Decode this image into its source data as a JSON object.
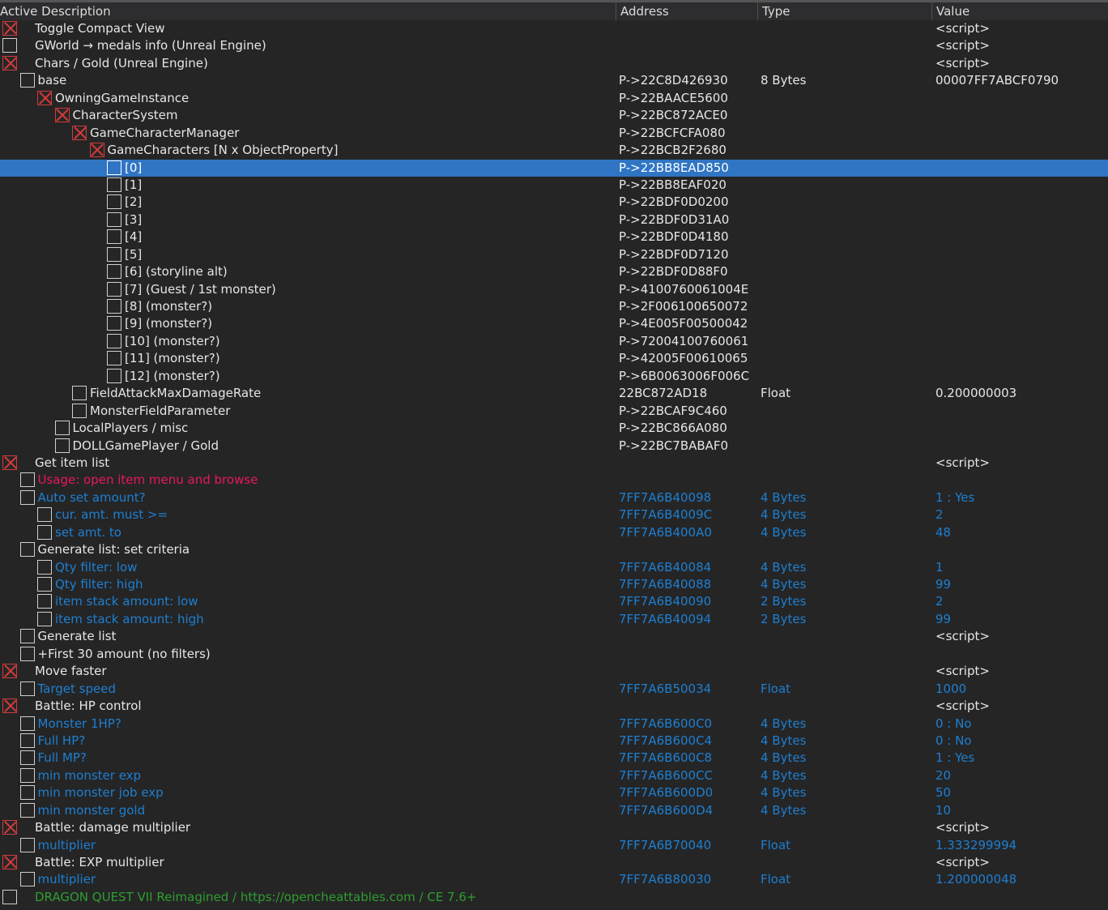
{
  "header": {
    "col_active_desc": "Active Description",
    "col_address": "Address",
    "col_type": "Type",
    "col_value": "Value"
  },
  "colors": {
    "selection": "#2f75c4",
    "blue_entry": "#1e7fd0",
    "usage": "#e8175d",
    "footer": "#2e9e2e",
    "checked_x": "#d23a3a"
  },
  "rows": [
    {
      "d": "Toggle Compact View",
      "a": "",
      "t": "",
      "v": "<script>",
      "lvl": 0,
      "chk": true,
      "c": ""
    },
    {
      "d": "GWorld → medals info  (Unreal Engine)",
      "a": "",
      "t": "",
      "v": "<script>",
      "lvl": 0,
      "chk": false,
      "c": ""
    },
    {
      "d": "Chars / Gold (Unreal Engine)",
      "a": "",
      "t": "",
      "v": "<script>",
      "lvl": 0,
      "chk": true,
      "c": ""
    },
    {
      "d": "base",
      "a": "P->22C8D426930",
      "t": "8 Bytes",
      "v": "00007FF7ABCF0790",
      "lvl": 1,
      "chk": false,
      "c": ""
    },
    {
      "d": "OwningGameInstance",
      "a": "P->22BAACE5600",
      "t": "",
      "v": "",
      "lvl": 2,
      "chk": true,
      "c": ""
    },
    {
      "d": "CharacterSystem",
      "a": "P->22BC872ACE0",
      "t": "",
      "v": "",
      "lvl": 3,
      "chk": true,
      "c": ""
    },
    {
      "d": "GameCharacterManager",
      "a": "P->22BCFCFA080",
      "t": "",
      "v": "",
      "lvl": 4,
      "chk": true,
      "c": ""
    },
    {
      "d": "GameCharacters [N x ObjectProperty]",
      "a": "P->22BCB2F2680",
      "t": "",
      "v": "",
      "lvl": 5,
      "chk": true,
      "c": ""
    },
    {
      "d": "[0]",
      "a": "P->22BB8EAD850",
      "t": "",
      "v": "",
      "lvl": 6,
      "chk": false,
      "c": "",
      "sel": true
    },
    {
      "d": "[1]",
      "a": "P->22BB8EAF020",
      "t": "",
      "v": "",
      "lvl": 6,
      "chk": false,
      "c": ""
    },
    {
      "d": "[2]",
      "a": "P->22BDF0D0200",
      "t": "",
      "v": "",
      "lvl": 6,
      "chk": false,
      "c": ""
    },
    {
      "d": "[3]",
      "a": "P->22BDF0D31A0",
      "t": "",
      "v": "",
      "lvl": 6,
      "chk": false,
      "c": ""
    },
    {
      "d": "[4]",
      "a": "P->22BDF0D4180",
      "t": "",
      "v": "",
      "lvl": 6,
      "chk": false,
      "c": ""
    },
    {
      "d": "[5]",
      "a": "P->22BDF0D7120",
      "t": "",
      "v": "",
      "lvl": 6,
      "chk": false,
      "c": ""
    },
    {
      "d": "[6] (storyline alt)",
      "a": "P->22BDF0D88F0",
      "t": "",
      "v": "",
      "lvl": 6,
      "chk": false,
      "c": ""
    },
    {
      "d": "[7] (Guest / 1st monster)",
      "a": "P->4100760061004E",
      "t": "",
      "v": "",
      "lvl": 6,
      "chk": false,
      "c": ""
    },
    {
      "d": "[8] (monster?)",
      "a": "P->2F006100650072",
      "t": "",
      "v": "",
      "lvl": 6,
      "chk": false,
      "c": ""
    },
    {
      "d": "[9] (monster?)",
      "a": "P->4E005F00500042",
      "t": "",
      "v": "",
      "lvl": 6,
      "chk": false,
      "c": ""
    },
    {
      "d": "[10] (monster?)",
      "a": "P->72004100760061",
      "t": "",
      "v": "",
      "lvl": 6,
      "chk": false,
      "c": ""
    },
    {
      "d": "[11] (monster?)",
      "a": "P->42005F00610065",
      "t": "",
      "v": "",
      "lvl": 6,
      "chk": false,
      "c": ""
    },
    {
      "d": "[12] (monster?)",
      "a": "P->6B0063006F006C",
      "t": "",
      "v": "",
      "lvl": 6,
      "chk": false,
      "c": ""
    },
    {
      "d": "FieldAttackMaxDamageRate",
      "a": "22BC872AD18",
      "t": "Float",
      "v": "0.200000003",
      "lvl": 4,
      "chk": false,
      "c": ""
    },
    {
      "d": "MonsterFieldParameter",
      "a": "P->22BCAF9C460",
      "t": "",
      "v": "",
      "lvl": 4,
      "chk": false,
      "c": ""
    },
    {
      "d": "LocalPlayers / misc",
      "a": "P->22BC866A080",
      "t": "",
      "v": "",
      "lvl": 3,
      "chk": false,
      "c": ""
    },
    {
      "d": "DOLLGamePlayer / Gold",
      "a": "P->22BC7BABAF0",
      "t": "",
      "v": "",
      "lvl": 3,
      "chk": false,
      "c": ""
    },
    {
      "d": "Get item list",
      "a": "",
      "t": "",
      "v": "<script>",
      "lvl": 0,
      "chk": true,
      "c": ""
    },
    {
      "d": "Usage: open item menu and browse",
      "a": "",
      "t": "",
      "v": "",
      "lvl": 1,
      "chk": false,
      "c": "pink"
    },
    {
      "d": "Auto set amount?",
      "a": "7FF7A6B40098",
      "t": "4 Bytes",
      "v": "1 : Yes",
      "lvl": 1,
      "chk": false,
      "c": "blue"
    },
    {
      "d": "cur. amt. must >=",
      "a": "7FF7A6B4009C",
      "t": "4 Bytes",
      "v": "2",
      "lvl": 2,
      "chk": false,
      "c": "blue"
    },
    {
      "d": "set amt. to",
      "a": "7FF7A6B400A0",
      "t": "4 Bytes",
      "v": "48",
      "lvl": 2,
      "chk": false,
      "c": "blue"
    },
    {
      "d": "Generate list: set criteria",
      "a": "",
      "t": "",
      "v": "",
      "lvl": 1,
      "chk": false,
      "c": ""
    },
    {
      "d": "Qty filter: low",
      "a": "7FF7A6B40084",
      "t": "4 Bytes",
      "v": "1",
      "lvl": 2,
      "chk": false,
      "c": "blue"
    },
    {
      "d": "Qty filter: high",
      "a": "7FF7A6B40088",
      "t": "4 Bytes",
      "v": "99",
      "lvl": 2,
      "chk": false,
      "c": "blue"
    },
    {
      "d": "item stack amount: low",
      "a": "7FF7A6B40090",
      "t": "2 Bytes",
      "v": "2",
      "lvl": 2,
      "chk": false,
      "c": "blue"
    },
    {
      "d": "item stack amount: high",
      "a": "7FF7A6B40094",
      "t": "2 Bytes",
      "v": "99",
      "lvl": 2,
      "chk": false,
      "c": "blue"
    },
    {
      "d": "Generate list",
      "a": "",
      "t": "",
      "v": "<script>",
      "lvl": 1,
      "chk": false,
      "c": ""
    },
    {
      "d": "+First 30 amount (no filters)",
      "a": "",
      "t": "",
      "v": "",
      "lvl": 1,
      "chk": false,
      "c": ""
    },
    {
      "d": "Move faster",
      "a": "",
      "t": "",
      "v": "<script>",
      "lvl": 0,
      "chk": true,
      "c": ""
    },
    {
      "d": "Target speed",
      "a": "7FF7A6B50034",
      "t": "Float",
      "v": "1000",
      "lvl": 1,
      "chk": false,
      "c": "blue"
    },
    {
      "d": "Battle: HP control",
      "a": "",
      "t": "",
      "v": "<script>",
      "lvl": 0,
      "chk": true,
      "c": ""
    },
    {
      "d": "Monster 1HP?",
      "a": "7FF7A6B600C0",
      "t": "4 Bytes",
      "v": "0 : No",
      "lvl": 1,
      "chk": false,
      "c": "blue"
    },
    {
      "d": "Full HP?",
      "a": "7FF7A6B600C4",
      "t": "4 Bytes",
      "v": "0 : No",
      "lvl": 1,
      "chk": false,
      "c": "blue"
    },
    {
      "d": "Full MP?",
      "a": "7FF7A6B600C8",
      "t": "4 Bytes",
      "v": "1 : Yes",
      "lvl": 1,
      "chk": false,
      "c": "blue"
    },
    {
      "d": "min monster exp",
      "a": "7FF7A6B600CC",
      "t": "4 Bytes",
      "v": "20",
      "lvl": 1,
      "chk": false,
      "c": "blue"
    },
    {
      "d": "min monster job exp",
      "a": "7FF7A6B600D0",
      "t": "4 Bytes",
      "v": "50",
      "lvl": 1,
      "chk": false,
      "c": "blue"
    },
    {
      "d": "min monster gold",
      "a": "7FF7A6B600D4",
      "t": "4 Bytes",
      "v": "10",
      "lvl": 1,
      "chk": false,
      "c": "blue"
    },
    {
      "d": "Battle: damage multiplier",
      "a": "",
      "t": "",
      "v": "<script>",
      "lvl": 0,
      "chk": true,
      "c": ""
    },
    {
      "d": "multiplier",
      "a": "7FF7A6B70040",
      "t": "Float",
      "v": "1.333299994",
      "lvl": 1,
      "chk": false,
      "c": "blue"
    },
    {
      "d": "Battle: EXP multiplier",
      "a": "",
      "t": "",
      "v": "<script>",
      "lvl": 0,
      "chk": true,
      "c": ""
    },
    {
      "d": "multiplier",
      "a": "7FF7A6B80030",
      "t": "Float",
      "v": "1.200000048",
      "lvl": 1,
      "chk": false,
      "c": "blue"
    },
    {
      "d": "DRAGON QUEST VII Reimagined  /  https://opencheattables.com  /  CE 7.6+",
      "a": "",
      "t": "",
      "v": "",
      "lvl": 0,
      "chk": false,
      "c": "green"
    }
  ]
}
